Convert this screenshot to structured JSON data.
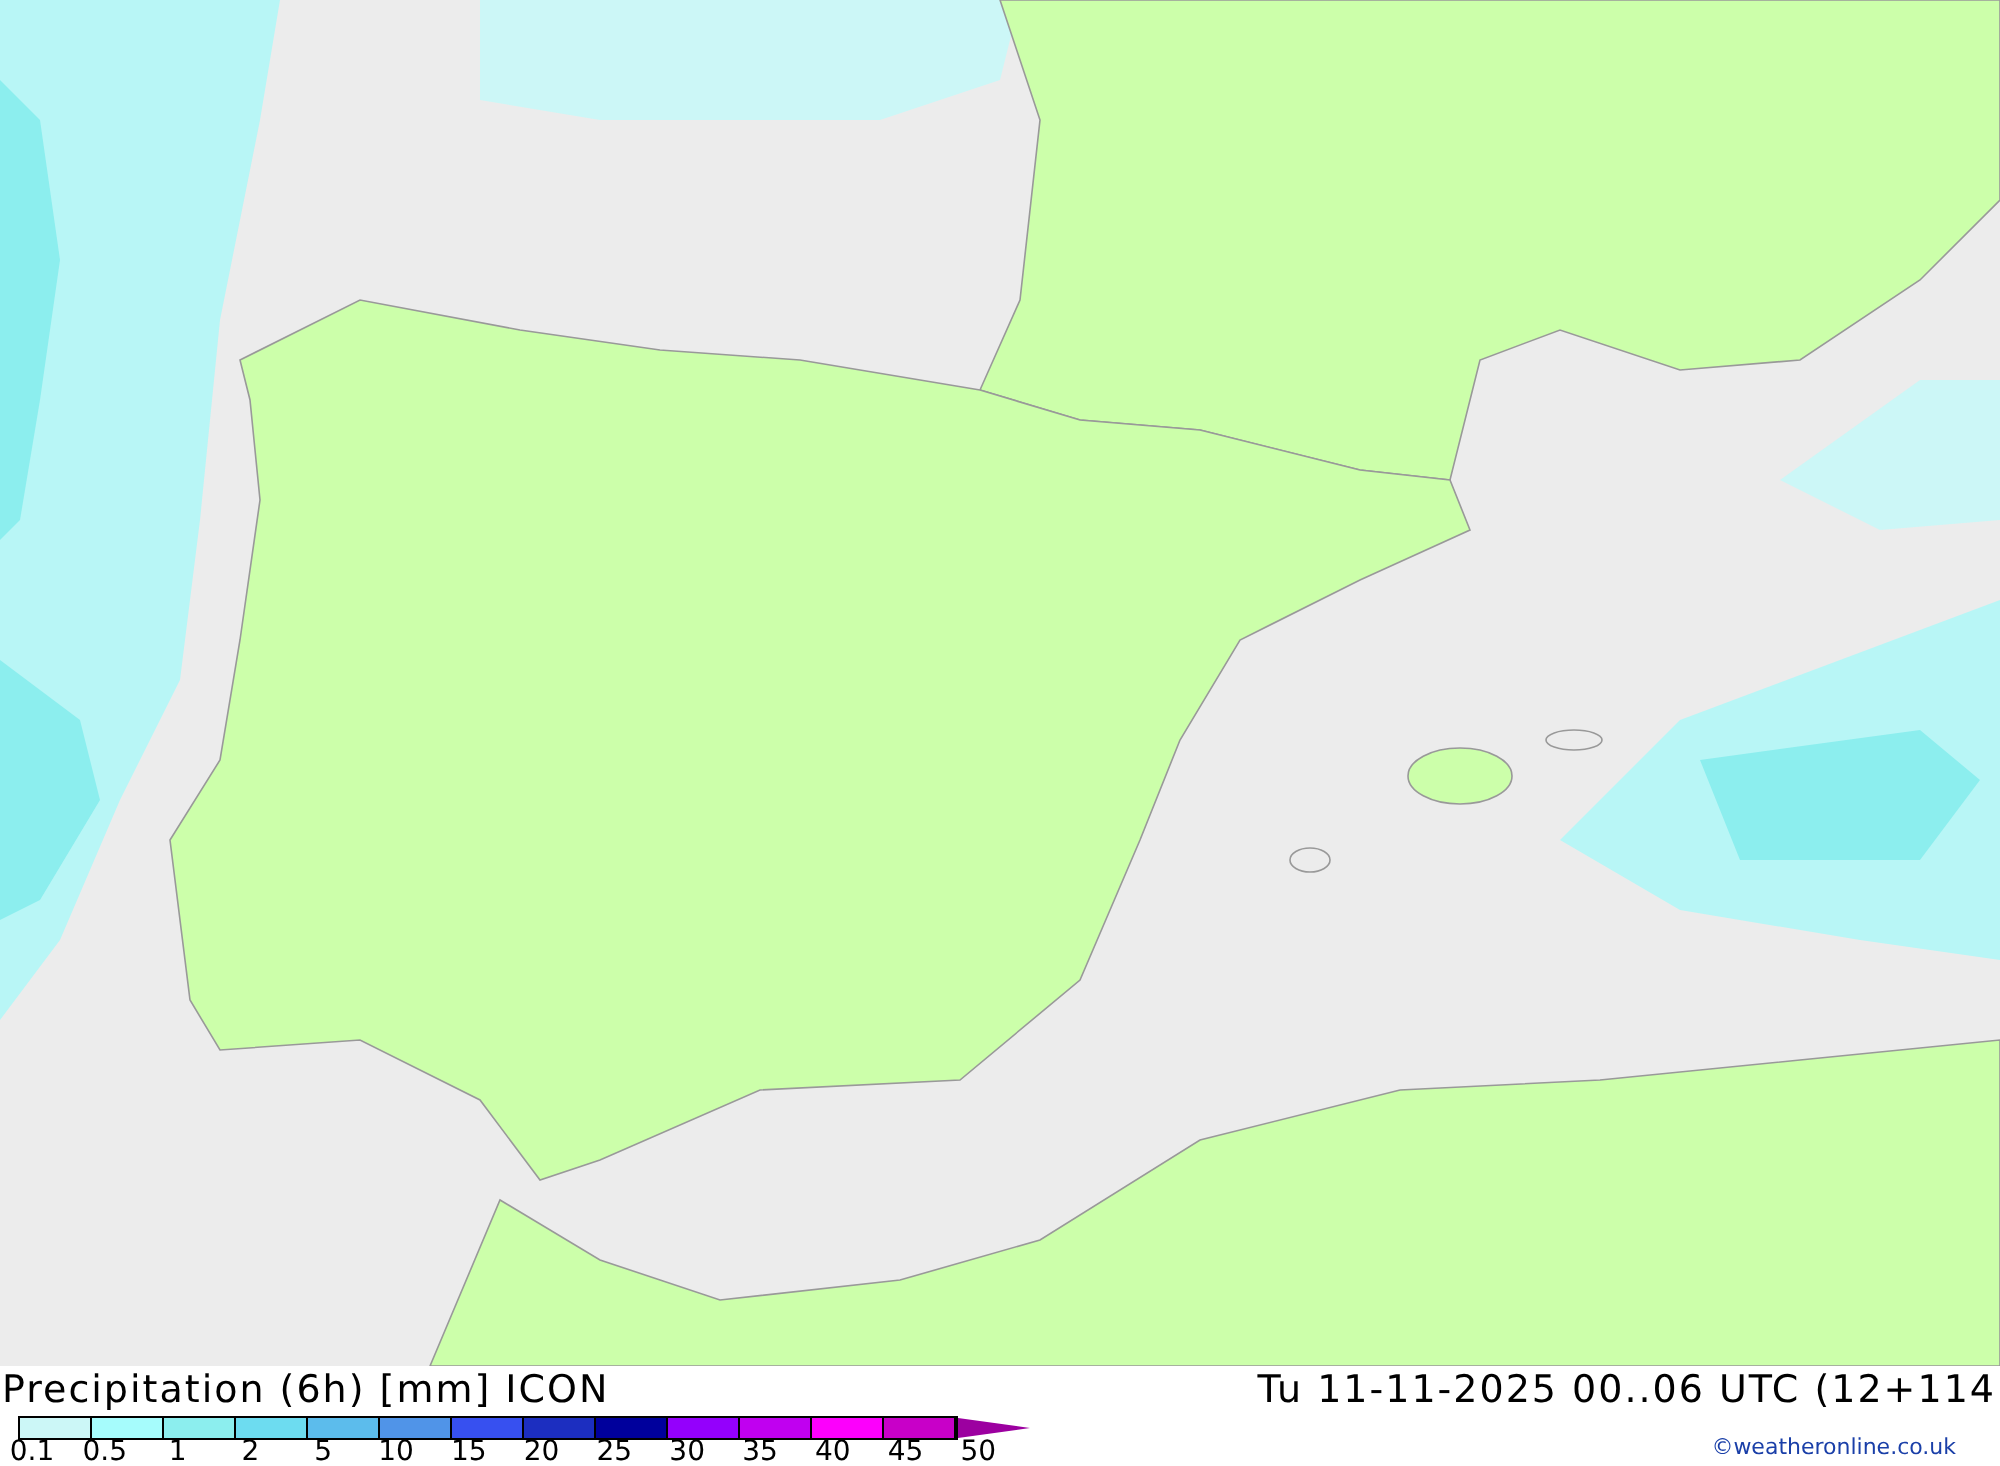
{
  "title": "Precipitation (6h) [mm] ICON",
  "valid_time": "Tu 11-11-2025 00..06 UTC (12+114",
  "legend": {
    "swatches": [
      {
        "color": "#ccf7f7"
      },
      {
        "color": "#a6fcfc"
      },
      {
        "color": "#8ceeee"
      },
      {
        "color": "#6ddcf0"
      },
      {
        "color": "#5cbcec"
      },
      {
        "color": "#5094e8"
      },
      {
        "color": "#3750f0"
      },
      {
        "color": "#1c2ec0"
      },
      {
        "color": "#00009c"
      },
      {
        "color": "#9400fc"
      },
      {
        "color": "#c000f0"
      },
      {
        "color": "#fc00fc"
      },
      {
        "color": "#c800c8"
      },
      {
        "kind": "arrow",
        "color": "#9c00a0"
      }
    ],
    "labels": [
      "0.1",
      "0.5",
      "1",
      "2",
      "5",
      "10",
      "15",
      "20",
      "25",
      "30",
      "35",
      "40",
      "45",
      "50"
    ]
  },
  "credit": "©weatheronline.co.uk"
}
